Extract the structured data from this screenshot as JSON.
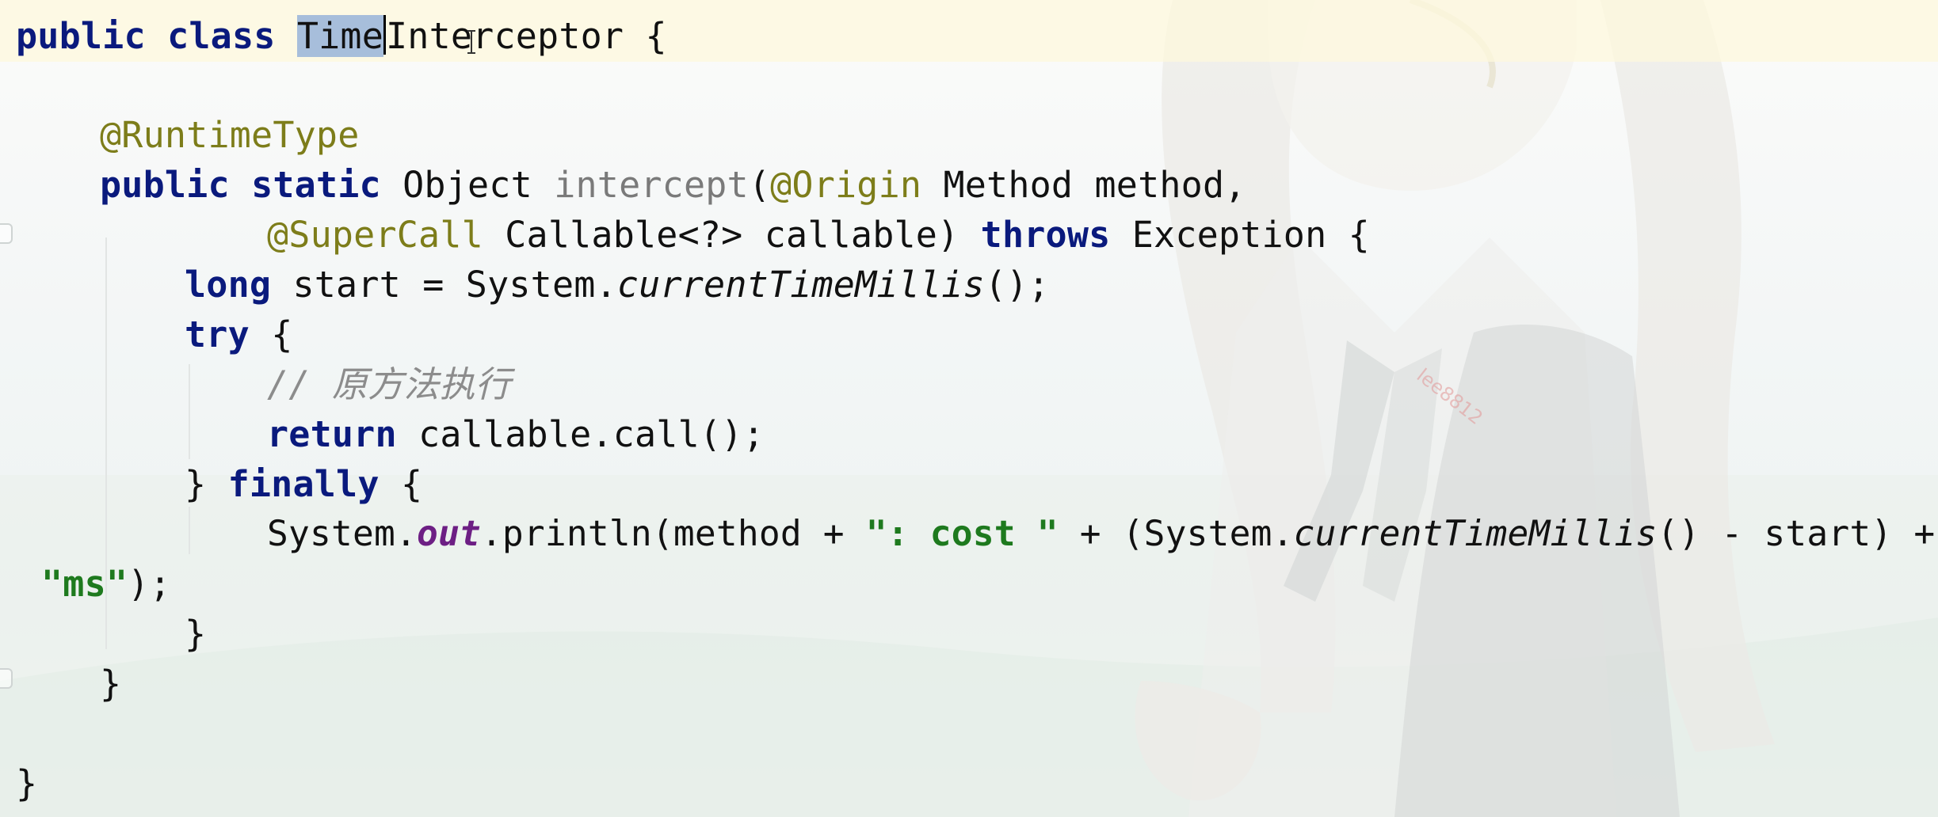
{
  "editor": {
    "language": "java",
    "selected_text": "Time",
    "lines": {
      "l1": {
        "kw1": "public",
        "kw2": "class",
        "sel": "Time",
        "rest": "Interceptor {"
      },
      "l2": {
        "ann": "@RuntimeType"
      },
      "l3": {
        "kw1": "public",
        "kw2": "static",
        "type": "Object",
        "name": "intercept",
        "paren": "(",
        "ann": "@Origin",
        "rest": "Method method,"
      },
      "l4": {
        "ann": "@SuperCall",
        "mid": "Callable<?> callable)",
        "kw": "throws",
        "rest": "Exception {"
      },
      "l5": {
        "kw": "long",
        "mid": "start = System.",
        "call": "currentTimeMillis",
        "rest": "();"
      },
      "l6": {
        "kw": "try",
        "rest": "{"
      },
      "l7": {
        "comment": "// 原方法执行"
      },
      "l8": {
        "kw": "return",
        "rest": "callable.call();"
      },
      "l9": {
        "pre": "}",
        "kw": "finally",
        "rest": "{"
      },
      "l10": {
        "pre": "System.",
        "field": "out",
        "mid": ".println(method + ",
        "str": "\": cost \"",
        "mid2": " + (System.",
        "call": "currentTimeMillis",
        "rest": "() - start) +"
      },
      "l11": {
        "str": "\"ms\"",
        "rest": ");"
      },
      "l12": {
        "brace": "}"
      },
      "l13": {
        "brace": "}"
      },
      "l14": {
        "brace": "}"
      }
    }
  },
  "watermark": "lee8812",
  "colors": {
    "keyword": "#0a1a7d",
    "annotation": "#7d7d1a",
    "string": "#1e7a1e",
    "static_field": "#6d1f84",
    "comment": "#8c8c8c",
    "selection": "#a7bedb",
    "current_line": "#fdf8dc"
  }
}
